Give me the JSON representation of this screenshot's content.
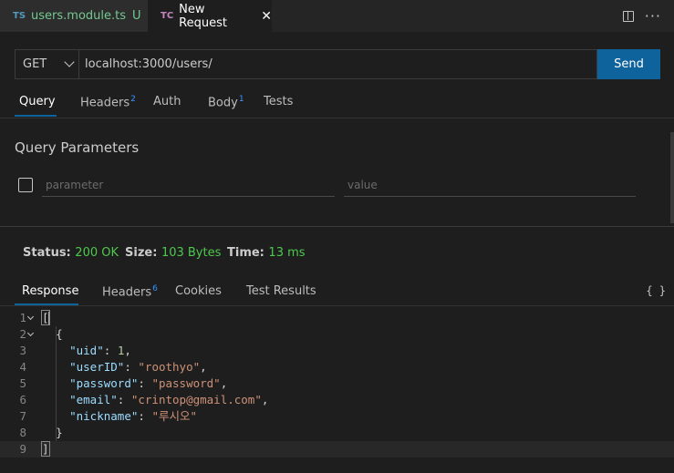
{
  "tabs": [
    {
      "badge": "TS",
      "name": "users.module.ts",
      "status": "U"
    },
    {
      "badge": "TC",
      "name": "New Request",
      "close": "✕"
    }
  ],
  "tab_actions": {
    "more": "···"
  },
  "request": {
    "method": "GET",
    "url": "localhost:3000/users/",
    "send_label": "Send"
  },
  "request_tabs": [
    {
      "label": "Query"
    },
    {
      "label": "Headers",
      "count": "2"
    },
    {
      "label": "Auth"
    },
    {
      "label": "Body",
      "count": "1"
    },
    {
      "label": "Tests"
    }
  ],
  "query": {
    "title": "Query Parameters",
    "param_placeholder": "parameter",
    "value_placeholder": "value"
  },
  "status": {
    "status_label": "Status:",
    "status_value": "200 OK",
    "size_label": "Size:",
    "size_value": "103 Bytes",
    "time_label": "Time:",
    "time_value": "13 ms"
  },
  "response_tabs": [
    {
      "label": "Response"
    },
    {
      "label": "Headers",
      "count": "6"
    },
    {
      "label": "Cookies"
    },
    {
      "label": "Test Results"
    }
  ],
  "response_format_icon": "{ }",
  "editor": {
    "line_numbers": [
      "1",
      "2",
      "3",
      "4",
      "5",
      "6",
      "7",
      "8",
      "9"
    ],
    "open_bracket": "[",
    "open_brace": "{",
    "uid_key": "\"uid\"",
    "uid_value": "1",
    "userid_key": "\"userID\"",
    "userid_value": "\"roothyo\"",
    "password_key": "\"password\"",
    "password_value": "\"password\"",
    "email_key": "\"email\"",
    "email_value": "\"crintop@gmail.com\"",
    "nickname_key": "\"nickname\"",
    "nickname_value": "\"루시오\"",
    "close_brace": "}",
    "close_bracket": "]"
  },
  "colors": {
    "send_button": "#0e639c",
    "status_ok": "#4ec94e",
    "json_key": "#9cdcfe",
    "json_string": "#ce9178",
    "json_number": "#b5cea8"
  }
}
